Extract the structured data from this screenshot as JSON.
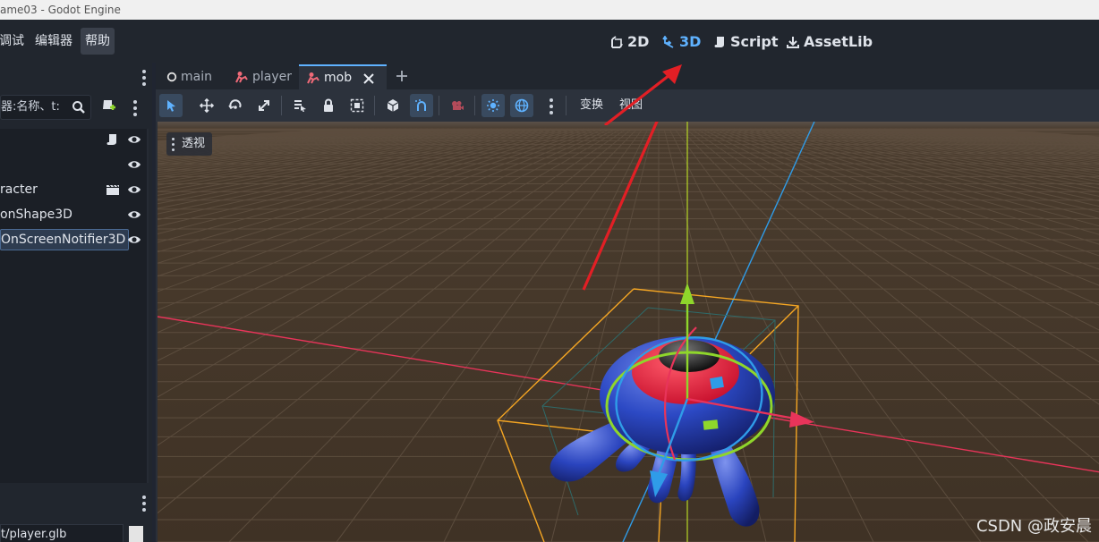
{
  "window": {
    "title": "ame03 - Godot Engine"
  },
  "menu": {
    "items": [
      "调试",
      "编辑器",
      "帮助"
    ]
  },
  "workspaces": {
    "d2": "2D",
    "d3": "3D",
    "script": "Script",
    "assetlib": "AssetLib"
  },
  "scene_dock": {
    "filter_placeholder": "器:名称、t:",
    "nodes": [
      {
        "label": "",
        "icon": "script-icon"
      },
      {
        "label": "",
        "icon": ""
      },
      {
        "label": "racter",
        "icon": "clapperboard-icon"
      },
      {
        "label": "onShape3D",
        "icon": ""
      },
      {
        "label": "OnScreenNotifier3D",
        "icon": ""
      }
    ]
  },
  "filesystem": {
    "path": "t/player.glb"
  },
  "tabs": {
    "main": "main",
    "player": "player",
    "mob": "mob"
  },
  "toolbar": {
    "transform": "变换",
    "view": "视图"
  },
  "viewport": {
    "perspective": "透视"
  },
  "watermark": "CSDN @政安晨",
  "colors": {
    "accent": "#5fb2ff",
    "x_axis": "#e8345a",
    "y_axis": "#8fd62b",
    "z_axis": "#2f9ce8",
    "arrow": "#e21f25",
    "bounds": "#f5a623"
  }
}
